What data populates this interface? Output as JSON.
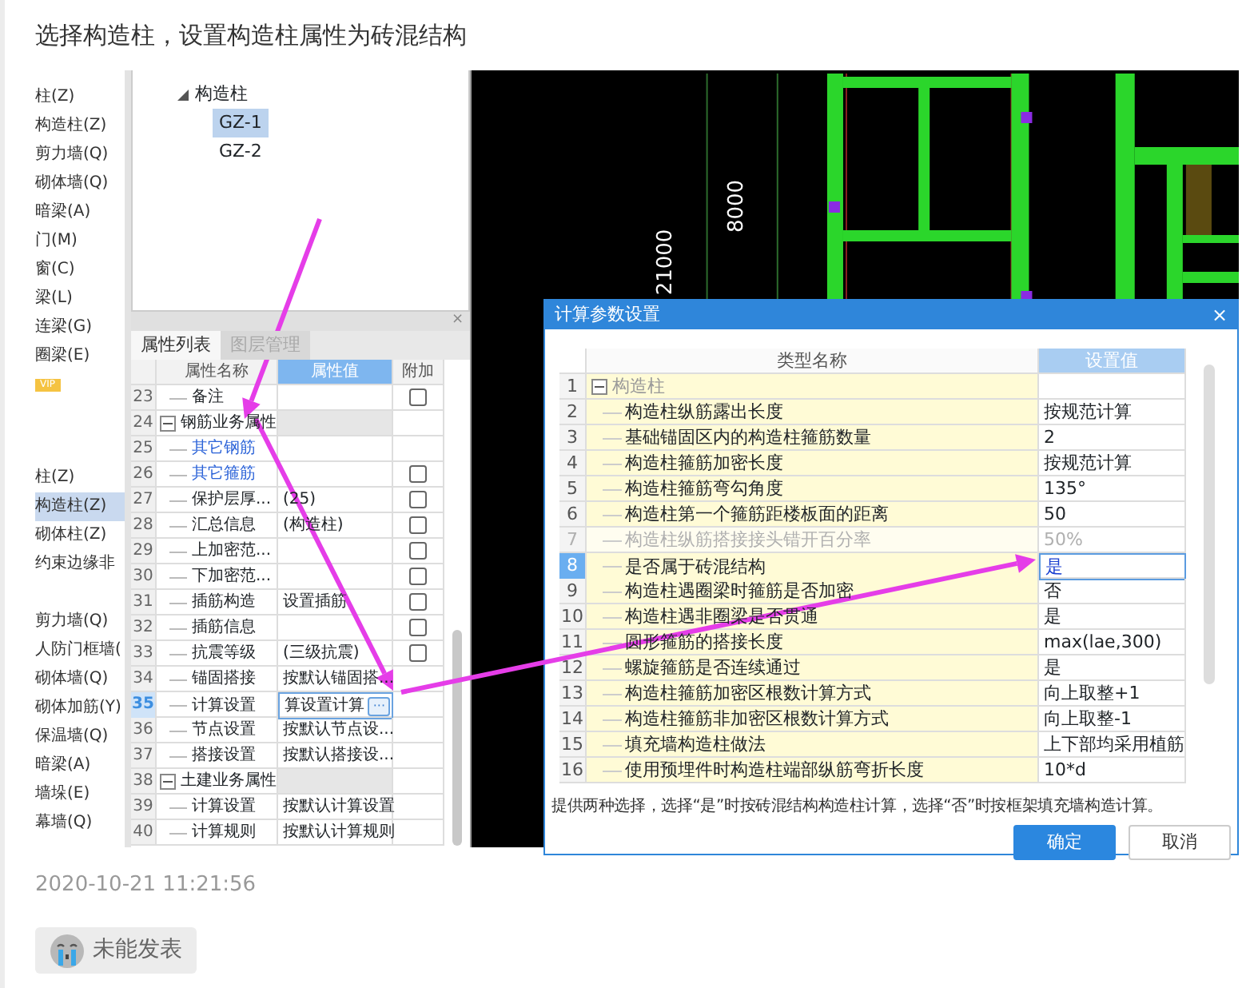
{
  "post": {
    "title": "选择构造柱，设置构造柱属性为砖混结构",
    "timestamp": "2020-10-21 11:21:56",
    "status_button": "未能发表"
  },
  "sidebar": {
    "groups": [
      {
        "items": [
          {
            "label": "柱(Z)",
            "selected": false
          },
          {
            "label": "构造柱(Z)",
            "selected": false
          },
          {
            "label": "剪力墙(Q)",
            "selected": false
          },
          {
            "label": "砌体墙(Q)",
            "selected": false
          },
          {
            "label": "暗梁(A)",
            "selected": false
          },
          {
            "label": "门(M)",
            "selected": false
          },
          {
            "label": "窗(C)",
            "selected": false
          },
          {
            "label": "梁(L)",
            "selected": false
          },
          {
            "label": "连梁(G)",
            "selected": false
          },
          {
            "label": "圈梁(E)",
            "selected": false
          }
        ],
        "badge": "VIP"
      },
      {
        "items": [
          {
            "label": "柱(Z)",
            "selected": false
          },
          {
            "label": "构造柱(Z)",
            "selected": true
          },
          {
            "label": "砌体柱(Z)",
            "selected": false
          },
          {
            "label": "约束边缘非",
            "selected": false
          }
        ]
      },
      {
        "items": [
          {
            "label": "剪力墙(Q)",
            "selected": false
          },
          {
            "label": "人防门框墙(",
            "selected": false
          },
          {
            "label": "砌体墙(Q)",
            "selected": false
          },
          {
            "label": "砌体加筋(Y)",
            "selected": false
          },
          {
            "label": "保温墙(Q)",
            "selected": false
          },
          {
            "label": "暗梁(A)",
            "selected": false
          },
          {
            "label": "墙垛(E)",
            "selected": false
          },
          {
            "label": "幕墙(Q)",
            "selected": false
          }
        ]
      }
    ]
  },
  "tree": {
    "label": "构造柱",
    "expanded": true,
    "children": [
      {
        "label": "GZ-1",
        "selected": true
      },
      {
        "label": "GZ-2",
        "selected": false
      }
    ]
  },
  "property_panel": {
    "close": "×",
    "tabs": [
      {
        "label": "属性列表",
        "selected": true
      },
      {
        "label": "图层管理",
        "selected": false
      }
    ],
    "columns": [
      "属性名称",
      "属性值",
      "附加"
    ],
    "rows": [
      {
        "num": "23",
        "kind": "item",
        "name": "备注",
        "selected": false,
        "checked": false
      },
      {
        "num": "24",
        "kind": "group",
        "name": "钢筋业务属性",
        "expanded": true,
        "selected": false
      },
      {
        "num": "25",
        "kind": "link",
        "name": "其它钢筋",
        "selected": false
      },
      {
        "num": "26",
        "kind": "link",
        "name": "其它箍筋",
        "selected": false,
        "checked": false
      },
      {
        "num": "27",
        "kind": "item",
        "name": "保护层厚...",
        "value": "(25)",
        "selected": false,
        "checked": false
      },
      {
        "num": "28",
        "kind": "item",
        "name": "汇总信息",
        "value": "(构造柱)",
        "selected": false,
        "checked": false
      },
      {
        "num": "29",
        "kind": "item",
        "name": "上加密范...",
        "selected": false,
        "checked": false
      },
      {
        "num": "30",
        "kind": "item",
        "name": "下加密范...",
        "selected": false,
        "checked": false
      },
      {
        "num": "31",
        "kind": "item",
        "name": "插筋构造",
        "value": "设置插筋",
        "selected": false,
        "checked": false
      },
      {
        "num": "32",
        "kind": "item",
        "name": "插筋信息",
        "selected": false,
        "checked": false
      },
      {
        "num": "33",
        "kind": "item",
        "name": "抗震等级",
        "value": "(三级抗震)",
        "selected": false,
        "checked": false
      },
      {
        "num": "34",
        "kind": "item",
        "name": "锚固搭接",
        "value": "按默认锚固搭...",
        "selected": false
      },
      {
        "num": "35",
        "kind": "item",
        "name": "计算设置",
        "value": "算设置计算",
        "button": "···",
        "selected": true
      },
      {
        "num": "36",
        "kind": "item",
        "name": "节点设置",
        "value": "按默认节点设...",
        "selected": false
      },
      {
        "num": "37",
        "kind": "item",
        "name": "搭接设置",
        "value": "按默认搭接设...",
        "selected": false
      },
      {
        "num": "38",
        "kind": "group",
        "name": "土建业务属性",
        "expanded": true,
        "selected": false
      },
      {
        "num": "39",
        "kind": "item",
        "name": "计算设置",
        "value": "按默认计算设置",
        "selected": false
      },
      {
        "num": "40",
        "kind": "item",
        "name": "计算规则",
        "value": "按默认计算规则",
        "selected": false
      }
    ]
  },
  "canvas": {
    "labels": [
      "8000",
      "21000"
    ]
  },
  "dialog": {
    "title": "计算参数设置",
    "close": "×",
    "columns": [
      "类型名称",
      "设置值"
    ],
    "rows": [
      {
        "num": "1",
        "kind": "group",
        "name": "构造柱",
        "expanded": true,
        "selected": false,
        "disabled": false
      },
      {
        "num": "2",
        "kind": "item",
        "name": "构造柱纵筋露出长度",
        "value": "按规范计算",
        "selected": false,
        "disabled": false
      },
      {
        "num": "3",
        "kind": "item",
        "name": "基础锚固区内的构造柱箍筋数量",
        "value": "2",
        "selected": false,
        "disabled": false
      },
      {
        "num": "4",
        "kind": "item",
        "name": "构造柱箍筋加密长度",
        "value": "按规范计算",
        "selected": false,
        "disabled": false
      },
      {
        "num": "5",
        "kind": "item",
        "name": "构造柱箍筋弯勾角度",
        "value": "135°",
        "selected": false,
        "disabled": false
      },
      {
        "num": "6",
        "kind": "item",
        "name": "构造柱第一个箍筋距楼板面的距离",
        "value": "50",
        "selected": false,
        "disabled": false
      },
      {
        "num": "7",
        "kind": "item",
        "name": "构造柱纵筋搭接接头错开百分率",
        "value": "50%",
        "selected": false,
        "disabled": true
      },
      {
        "num": "8",
        "kind": "item",
        "name": "是否属于砖混结构",
        "value": "是",
        "selected": true,
        "disabled": false
      },
      {
        "num": "9",
        "kind": "item",
        "name": "构造柱遇圈梁时箍筋是否加密",
        "value": "否",
        "selected": false,
        "disabled": false
      },
      {
        "num": "10",
        "kind": "item",
        "name": "构造柱遇非圈梁是否贯通",
        "value": "是",
        "selected": false,
        "disabled": false
      },
      {
        "num": "11",
        "kind": "item",
        "name": "圆形箍筋的搭接长度",
        "value": "max(lae,300)",
        "selected": false,
        "disabled": false
      },
      {
        "num": "12",
        "kind": "item",
        "name": "螺旋箍筋是否连续通过",
        "value": "是",
        "selected": false,
        "disabled": false
      },
      {
        "num": "13",
        "kind": "item",
        "name": "构造柱箍筋加密区根数计算方式",
        "value": "向上取整+1",
        "selected": false,
        "disabled": false
      },
      {
        "num": "14",
        "kind": "item",
        "name": "构造柱箍筋非加密区根数计算方式",
        "value": "向上取整-1",
        "selected": false,
        "disabled": false
      },
      {
        "num": "15",
        "kind": "item",
        "name": "填充墙构造柱做法",
        "value": "上下部均采用植筋",
        "selected": false,
        "disabled": false
      },
      {
        "num": "16",
        "kind": "item",
        "name": "使用预埋件时构造柱端部纵筋弯折长度",
        "value": "10*d",
        "selected": false,
        "disabled": false
      }
    ],
    "hint": "提供两种选择，选择“是”时按砖混结构构造柱计算，选择“否”时按框架填充墙构造计算。",
    "buttons": [
      {
        "label": "确定",
        "kind": "primary"
      },
      {
        "label": "取消",
        "kind": "secondary"
      }
    ]
  }
}
